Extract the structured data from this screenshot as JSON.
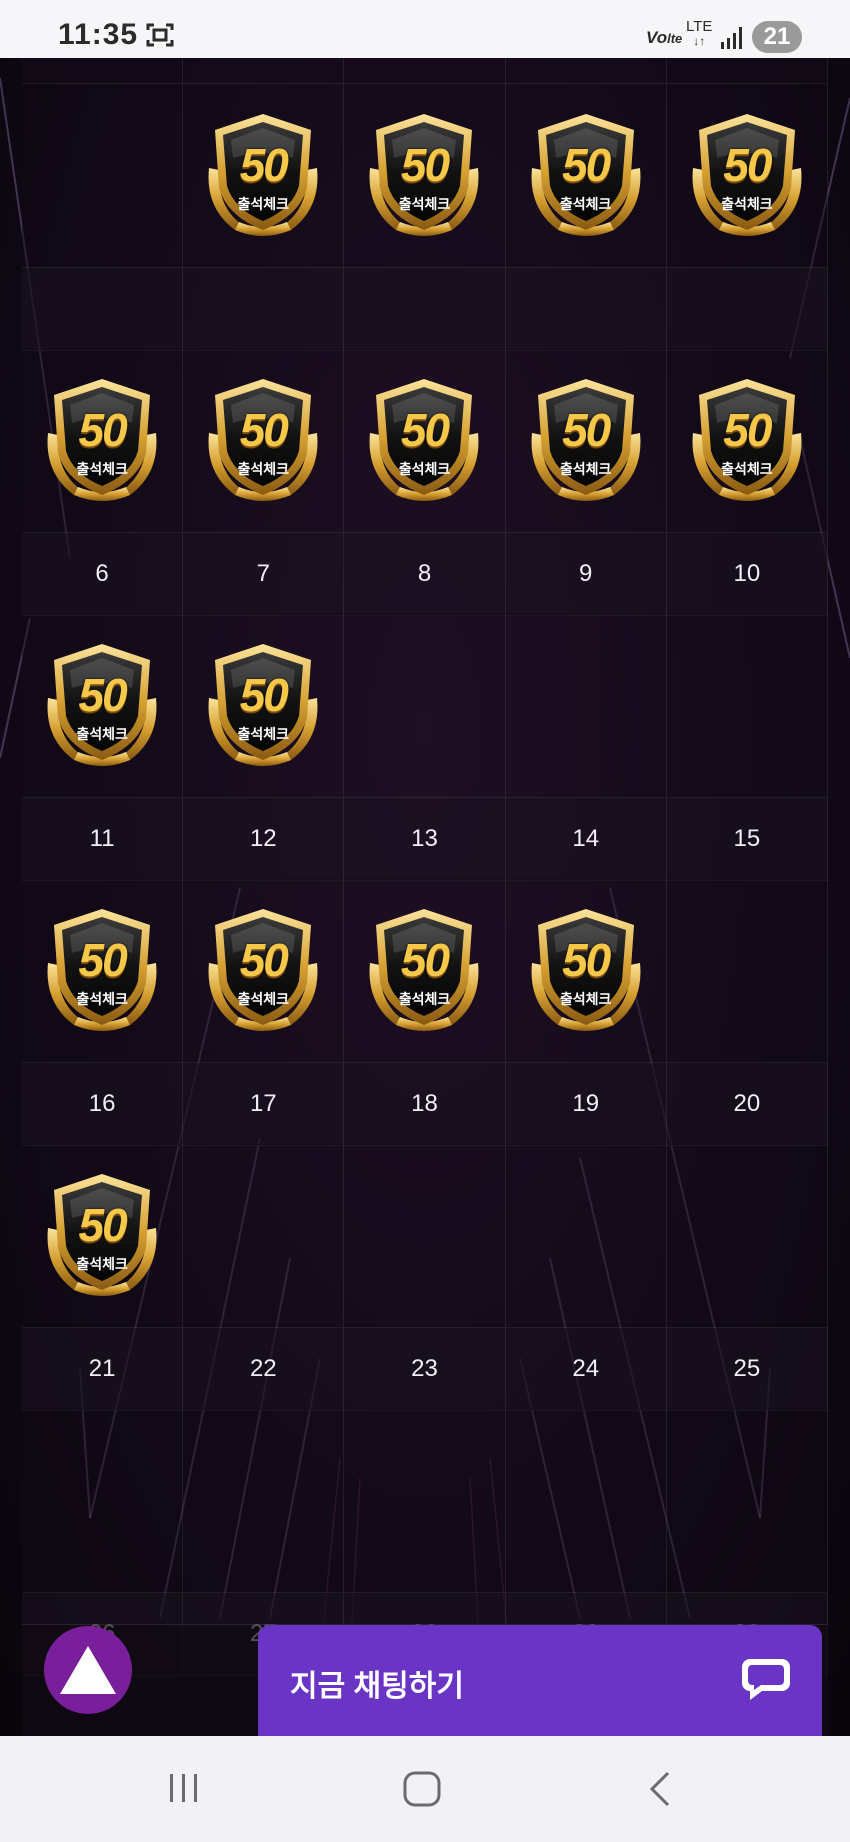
{
  "status_bar": {
    "time": "11:35",
    "volte": "Vo",
    "volte_suffix": "lte",
    "network": "LTE",
    "battery": "21"
  },
  "badge": {
    "number": "50",
    "label": "출석체크"
  },
  "calendar": {
    "weeks": [
      {
        "days": [
          "",
          "",
          "",
          "",
          ""
        ],
        "stamped": [
          false,
          true,
          true,
          true,
          true
        ]
      },
      {
        "days": [
          "6",
          "7",
          "8",
          "9",
          "10"
        ],
        "stamped": [
          true,
          true,
          true,
          true,
          true
        ]
      },
      {
        "days": [
          "11",
          "12",
          "13",
          "14",
          "15"
        ],
        "stamped": [
          true,
          true,
          false,
          false,
          false
        ]
      },
      {
        "days": [
          "16",
          "17",
          "18",
          "19",
          "20"
        ],
        "stamped": [
          true,
          true,
          true,
          true,
          false
        ]
      },
      {
        "days": [
          "21",
          "22",
          "23",
          "24",
          "25"
        ],
        "stamped": [
          true,
          false,
          false,
          false,
          false
        ]
      },
      {
        "days": [
          "26",
          "27",
          "28",
          "29",
          "30"
        ],
        "stamped": [
          false,
          false,
          false,
          false,
          false
        ]
      }
    ]
  },
  "chat_button": {
    "label": "지금 채팅하기"
  },
  "colors": {
    "chat_button": "#6a35c4",
    "up_button": "#7a1f9c"
  }
}
